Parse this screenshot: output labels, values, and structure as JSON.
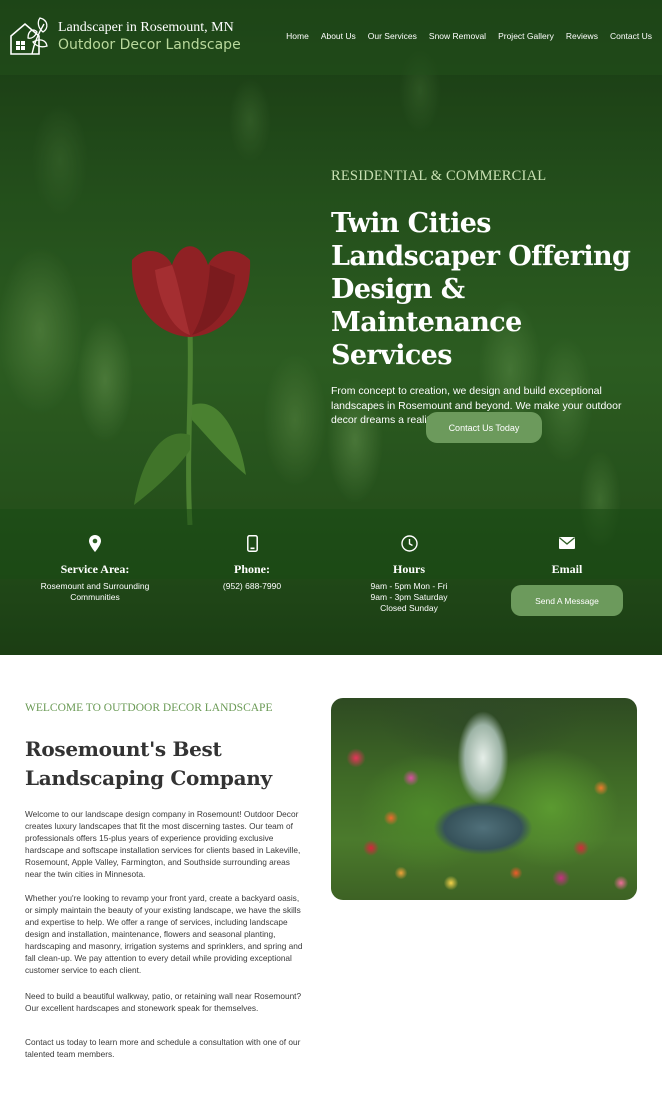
{
  "header": {
    "brand_line1": "Landscaper in Rosemount, MN",
    "brand_line2": "Outdoor Decor Landscape",
    "nav": [
      "Home",
      "About Us",
      "Our Services",
      "Snow Removal",
      "Project Gallery",
      "Reviews",
      "Contact Us"
    ]
  },
  "hero": {
    "eyebrow": "RESIDENTIAL & COMMERCIAL",
    "headline": "Twin Cities Landscaper Offering Design & Maintenance Services",
    "description": "From concept to creation, we design and build exceptional landscapes in Rosemount and beyond. We make your outdoor decor dreams a reality.",
    "cta_label": "Contact Us Today"
  },
  "info": [
    {
      "icon": "map-pin-icon",
      "title": "Service Area:",
      "lines": [
        "Rosemount and Surrounding",
        "Communities"
      ]
    },
    {
      "icon": "mobile-phone-icon",
      "title": "Phone:",
      "lines": [
        "(952) 688-7990"
      ]
    },
    {
      "icon": "clock-icon",
      "title": "Hours",
      "lines": [
        "9am - 5pm Mon - Fri",
        "9am - 3pm Saturday",
        "Closed Sunday"
      ]
    },
    {
      "icon": "envelope-icon",
      "title": "Email",
      "button": "Send A Message"
    }
  ],
  "welcome": {
    "eyebrow": "WELCOME TO OUTDOOR DECOR LANDSCAPE",
    "title": "Rosemount's Best Landscaping Company",
    "paragraphs": [
      "Welcome to our landscape design company in Rosemount! Outdoor Decor creates luxury landscapes that fit the most discerning tastes. Our team of professionals offers 15-plus years of experience providing exclusive hardscape and softscape installation services for clients based in Lakeville, Rosemount, Apple Valley, Farmington, and Southside surrounding areas near the twin cities in Minnesota.",
      "Whether you're looking to revamp your front yard, create a backyard oasis, or simply maintain the beauty of your existing landscape, we have the skills and expertise to help. We offer a range of services, including landscape design and installation, maintenance, flowers and seasonal planting, hardscaping and masonry, irrigation systems and sprinklers, and spring and fall clean-up. We pay attention to every detail while providing exceptional customer service to each client.",
      "Need to build a beautiful walkway, patio, or retaining wall near Rosemount? Our excellent hardscapes and stonework speak for themselves.",
      "Contact us today to learn more and schedule a consultation with one of our talented team members."
    ]
  },
  "colors": {
    "accent_green": "#6c9a5c",
    "eyebrow_green": "#6a9a55",
    "hero_dark": "#2a5a21"
  }
}
